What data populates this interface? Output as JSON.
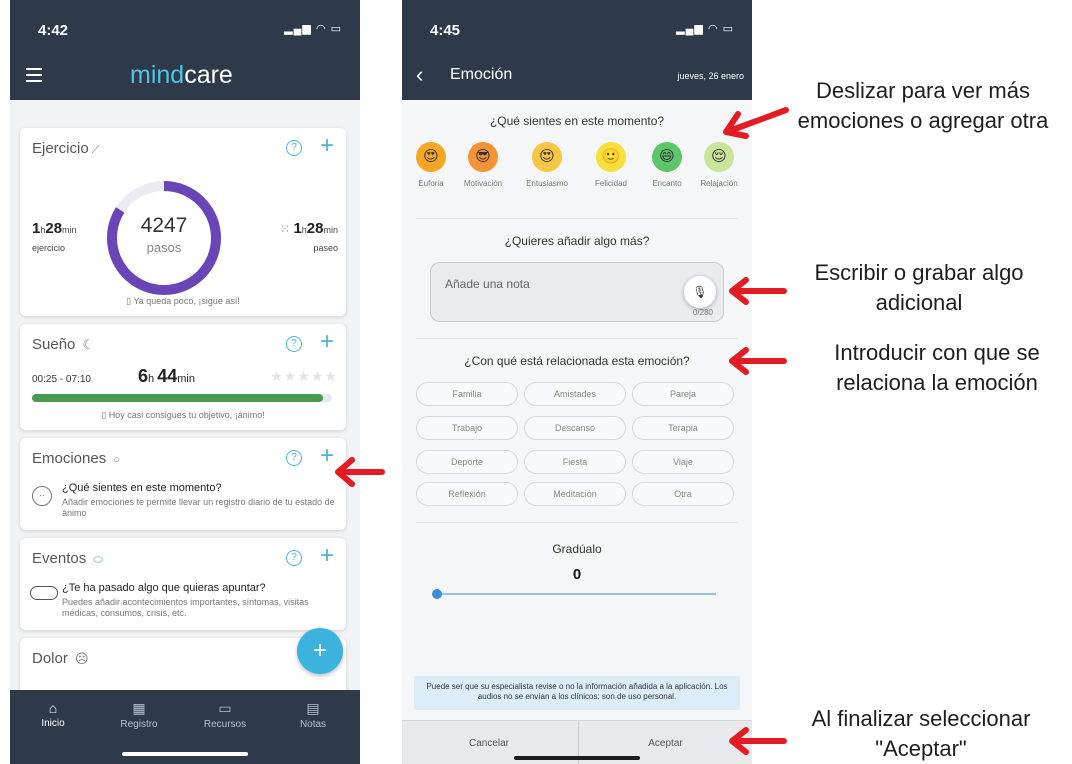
{
  "left_screen": {
    "status_time": "4:42",
    "brand": {
      "part1": "mind",
      "part2": "care"
    },
    "exercise": {
      "title": "Ejercicio",
      "steps": "4247",
      "steps_label": "pasos",
      "steps_progress_fraction": 0.84,
      "exercise_hours": "1",
      "exercise_minutes": "28",
      "exercise_label": "ejercicio",
      "walk_hours": "1",
      "walk_minutes": "28",
      "walk_label": "paseo",
      "hour_unit": "h",
      "minute_unit": "min",
      "note": "Ya queda poco, ¡sigue así!"
    },
    "sleep": {
      "title": "Sueño",
      "range": "00:25 - 07:10",
      "hours": "6",
      "minutes": "44",
      "progress_fraction": 0.97,
      "note": "Hoy casi consigues tu objetivo, ¡ánimo!"
    },
    "emotions": {
      "title": "Emociones",
      "question": "¿Qué sientes en este momento?",
      "description": "Añadir emociones te permite llevar un registro diario de tu estado de ánimo"
    },
    "events": {
      "title": "Eventos",
      "question": "¿Te ha pasado algo que quieras apuntar?",
      "description": "Puedes añadir acontecimientos importantes, síntomas, visitas médicas, consumos, crisis, etc."
    },
    "pain": {
      "title": "Dolor"
    },
    "fab_label": "+",
    "tabs": [
      {
        "label": "Inicio",
        "icon": "home-icon"
      },
      {
        "label": "Registro",
        "icon": "calendar-icon"
      },
      {
        "label": "Recursos",
        "icon": "book-icon"
      },
      {
        "label": "Notas",
        "icon": "note-icon"
      }
    ]
  },
  "right_screen": {
    "status_time": "4:45",
    "title": "Emoción",
    "date": "jueves, 26 enero",
    "question_feel": "¿Qué sientes en este momento?",
    "emotions": [
      {
        "label": "Euforia",
        "glyph": "😍",
        "color": "#f5a623"
      },
      {
        "label": "Motivación",
        "glyph": "😎",
        "color": "#f39237"
      },
      {
        "label": "Entusiasmo",
        "glyph": "😍",
        "color": "#f7c744"
      },
      {
        "label": "Felicidad",
        "glyph": "🙂",
        "color": "#f7e03c"
      },
      {
        "label": "Encanto",
        "glyph": "😄",
        "color": "#5cc66a"
      },
      {
        "label": "Relajación",
        "glyph": "😌",
        "color": "#c9e59a"
      }
    ],
    "question_more": "¿Quieres añadir algo más?",
    "note_placeholder": "Añade una nota",
    "note_count": "0/280",
    "question_related": "¿Con qué está relacionada esta emoción?",
    "tags": [
      "Familia",
      "Amistades",
      "Pareja",
      "Trabajo",
      "Descanso",
      "Terapia",
      "Deporte",
      "Fiesta",
      "Viaje",
      "Reflexión",
      "Meditación",
      "Otra"
    ],
    "grade_title": "Gradúalo",
    "grade_value": "0",
    "disclaimer": "Puede ser que su especialista revise o no la información añadida a la aplicación. Los audios no se envían a los clínicos: son de uso personal.",
    "cancel_label": "Cancelar",
    "accept_label": "Aceptar"
  },
  "annotations": {
    "swipe": "Deslizar para ver más emociones o agregar otra",
    "write": "Escribir o grabar algo adicional",
    "relate": "Introducir con que se relaciona la emoción",
    "finish": "Al finalizar seleccionar \"Aceptar\""
  },
  "colors": {
    "header": "#2e3a4a",
    "accent": "#3bb3dd",
    "ring": "#6a45b8",
    "sleep_bar": "#4a9a4e",
    "arrow": "#e31b23"
  }
}
